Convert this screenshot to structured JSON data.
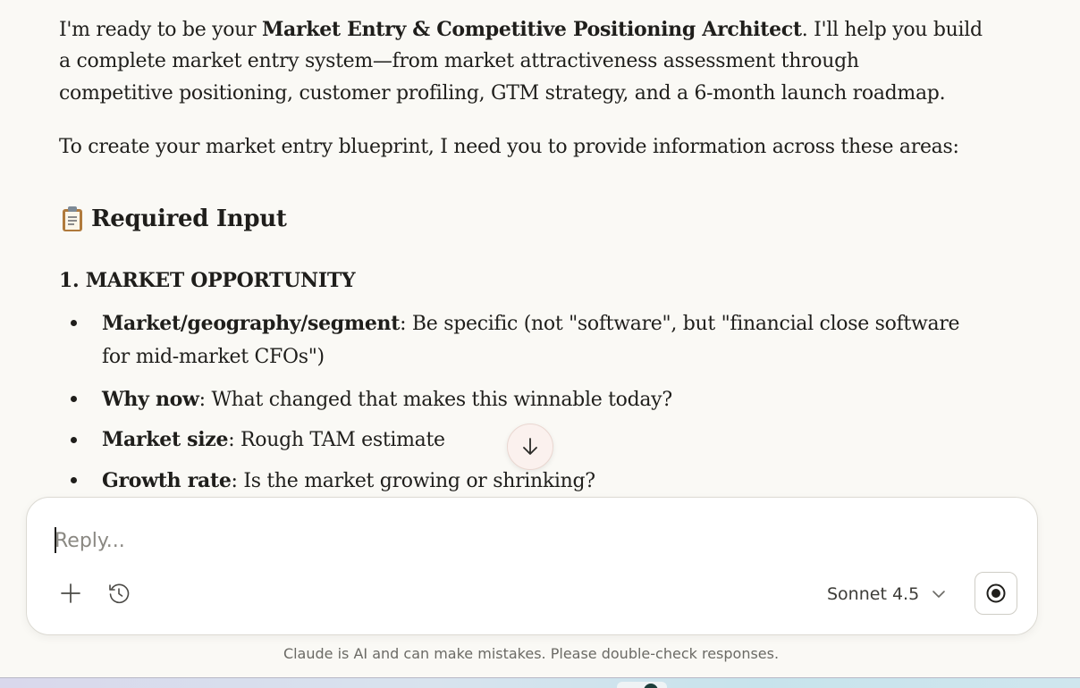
{
  "message": {
    "intro_line1_pre": "I'm ready to be your ",
    "intro_line1_bold": "Market Entry & Competitive Positioning Architect",
    "intro_line1_post": ". I'll help you build",
    "intro_line2": "a complete market entry system—from market attractiveness assessment through",
    "intro_line3": "competitive positioning, customer profiling, GTM strategy, and a 6-month launch roadmap.",
    "request": "To create your market entry blueprint, I need you to provide information across these areas:",
    "heading": "Required Input",
    "heading_icon": "clipboard-icon",
    "section_title": "1. MARKET OPPORTUNITY",
    "bullets": [
      {
        "label": "Market/geography/segment",
        "text": ": Be specific (not \"software\", but \"financial close software",
        "text_cont": "for mid-market CFOs\")"
      },
      {
        "label": "Why now",
        "text": ": What changed that makes this winnable today?"
      },
      {
        "label": "Market size",
        "text": ": Rough TAM estimate"
      },
      {
        "label": "Growth rate",
        "text": ": Is the market growing or shrinking?"
      }
    ]
  },
  "scroll_button": {
    "icon": "arrow-down-icon"
  },
  "composer": {
    "placeholder": "Reply...",
    "value": "",
    "add_icon": "plus-icon",
    "history_icon": "clock-history-icon",
    "model_label": "Sonnet 4.5",
    "model_icon": "chevron-down-icon",
    "voice_icon": "voice-mode-icon"
  },
  "footer": {
    "disclaimer": "Claude is AI and can make mistakes. Please double-check responses."
  },
  "colors": {
    "page_bg": "#faf9f5",
    "text": "#1f1e1b",
    "muted": "#6b6a65",
    "scroll_btn_bg": "#fbf1ee"
  }
}
